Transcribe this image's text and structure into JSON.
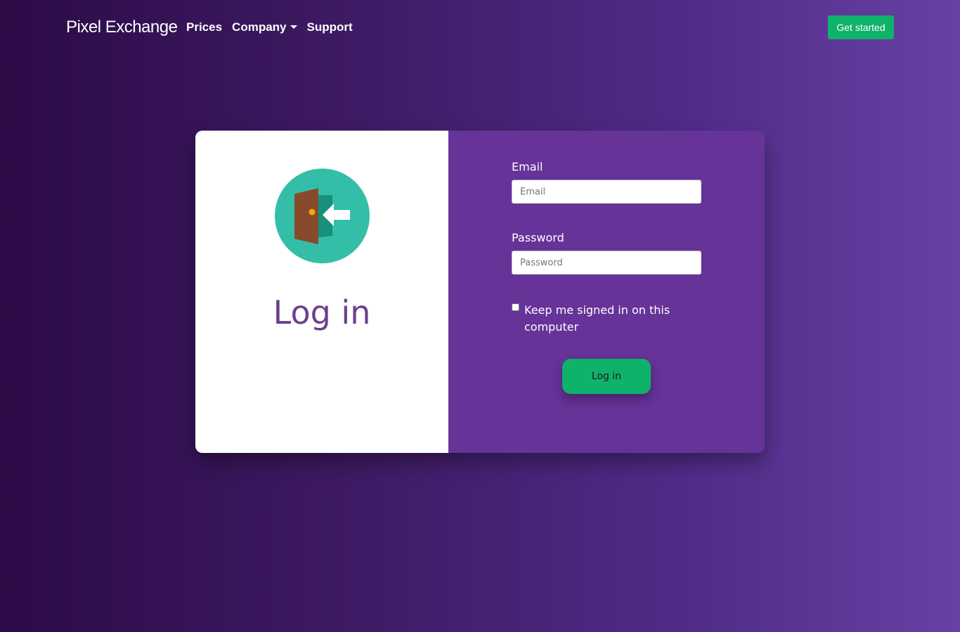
{
  "nav": {
    "brand": "Pixel Exchange",
    "links": [
      {
        "label": "Prices"
      },
      {
        "label": "Company"
      },
      {
        "label": "Support"
      }
    ],
    "cta_label": "Get started"
  },
  "login": {
    "title": "Log in",
    "email_label": "Email",
    "email_placeholder": "Email",
    "password_label": "Password",
    "password_placeholder": "Password",
    "remember_label": "Keep me signed in on this computer",
    "submit_label": "Log in"
  },
  "colors": {
    "accent": "#0fb26a",
    "panel": "#663399",
    "title": "#6b3f8e"
  },
  "icons": {
    "login": "door-enter-icon",
    "dropdown": "chevron-down-icon"
  }
}
